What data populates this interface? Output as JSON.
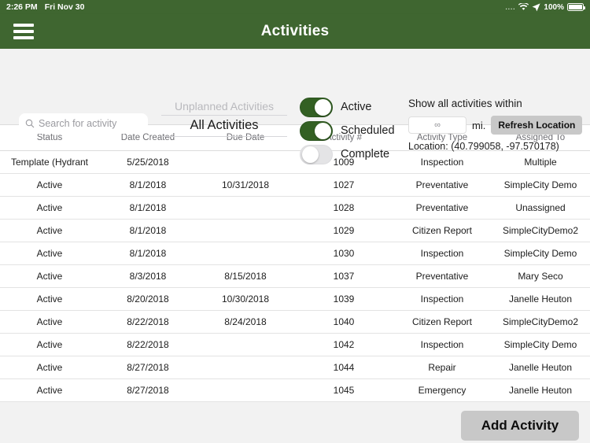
{
  "statusbar": {
    "time": "2:26 PM",
    "date": "Fri Nov 30",
    "dots": "....",
    "wifi_icon": "wifi-icon",
    "location_icon": "location-arrow-icon",
    "battery_percent": "100%",
    "battery_icon": "battery-full-icon"
  },
  "navbar": {
    "menu_icon": "hamburger-menu-icon",
    "title": "Activities"
  },
  "filters": {
    "search": {
      "icon": "search-icon",
      "placeholder": "Search for activity",
      "value": ""
    },
    "picker": {
      "unselected_option": "Unplanned Activities",
      "selected_option": "All Activities"
    },
    "toggles": [
      {
        "label": "Active",
        "on": true
      },
      {
        "label": "Scheduled",
        "on": true
      },
      {
        "label": "Complete",
        "on": false
      }
    ],
    "location": {
      "title": "Show all activities within",
      "distance_value": "∞",
      "unit_label": "mi.",
      "refresh_label": "Refresh Location",
      "coordinates": "Location: (40.799058, -97.570178)"
    }
  },
  "table": {
    "columns": [
      "Status",
      "Date Created",
      "Due Date",
      "Activity #",
      "Activity Type",
      "Assigned To"
    ],
    "rows": [
      {
        "status": "Template (Hydrant",
        "created": "5/25/2018",
        "due": "",
        "number": "1009",
        "type": "Inspection",
        "assigned": "Multiple"
      },
      {
        "status": "Active",
        "created": "8/1/2018",
        "due": "10/31/2018",
        "number": "1027",
        "type": "Preventative",
        "assigned": "SimpleCity Demo"
      },
      {
        "status": "Active",
        "created": "8/1/2018",
        "due": "",
        "number": "1028",
        "type": "Preventative",
        "assigned": "Unassigned"
      },
      {
        "status": "Active",
        "created": "8/1/2018",
        "due": "",
        "number": "1029",
        "type": "Citizen Report",
        "assigned": "SimpleCityDemo2"
      },
      {
        "status": "Active",
        "created": "8/1/2018",
        "due": "",
        "number": "1030",
        "type": "Inspection",
        "assigned": "SimpleCity Demo"
      },
      {
        "status": "Active",
        "created": "8/3/2018",
        "due": "8/15/2018",
        "number": "1037",
        "type": "Preventative",
        "assigned": "Mary Seco"
      },
      {
        "status": "Active",
        "created": "8/20/2018",
        "due": "10/30/2018",
        "number": "1039",
        "type": "Inspection",
        "assigned": "Janelle Heuton"
      },
      {
        "status": "Active",
        "created": "8/22/2018",
        "due": "8/24/2018",
        "number": "1040",
        "type": "Citizen Report",
        "assigned": "SimpleCityDemo2"
      },
      {
        "status": "Active",
        "created": "8/22/2018",
        "due": "",
        "number": "1042",
        "type": "Inspection",
        "assigned": "SimpleCity Demo"
      },
      {
        "status": "Active",
        "created": "8/27/2018",
        "due": "",
        "number": "1044",
        "type": "Repair",
        "assigned": "Janelle Heuton"
      },
      {
        "status": "Active",
        "created": "8/27/2018",
        "due": "",
        "number": "1045",
        "type": "Emergency",
        "assigned": "Janelle Heuton"
      }
    ]
  },
  "footer": {
    "add_label": "Add Activity"
  },
  "colors": {
    "brand_green": "#3f6630",
    "toggle_on_green": "#336023",
    "button_grey": "#c8c8c8",
    "page_bg": "#f2f2f2"
  }
}
